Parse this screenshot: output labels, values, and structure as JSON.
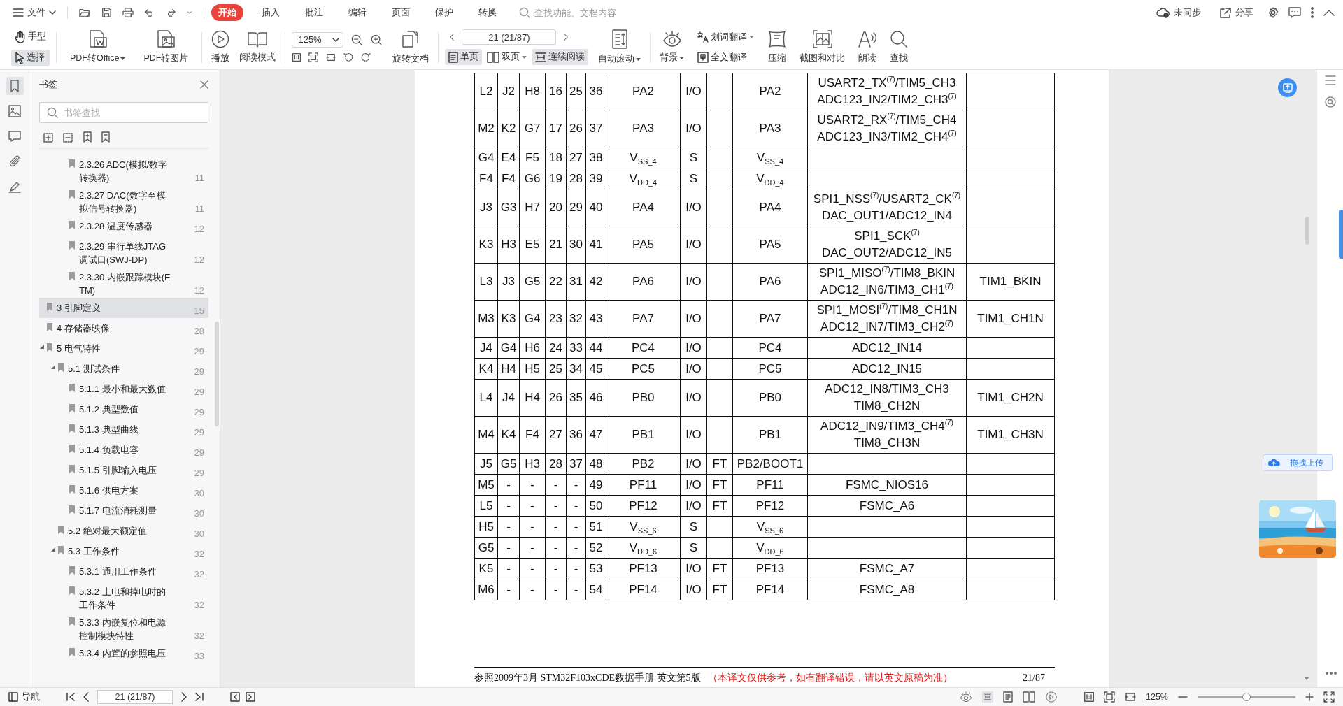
{
  "menu": {
    "file": "文件",
    "tabs": [
      {
        "label": "开始",
        "selected": true
      },
      {
        "label": "插入",
        "selected": false
      },
      {
        "label": "批注",
        "selected": false
      },
      {
        "label": "编辑",
        "selected": false
      },
      {
        "label": "页面",
        "selected": false
      },
      {
        "label": "保护",
        "selected": false
      },
      {
        "label": "转换",
        "selected": false
      }
    ],
    "search": {
      "placeholder": "查找功能、文档内容"
    },
    "sync": "未同步",
    "share": "分享"
  },
  "toolbar": {
    "tools": [
      {
        "label": "手型",
        "selected": false
      },
      {
        "label": "选择",
        "selected": true
      }
    ],
    "convert": [
      {
        "label": "PDF转Office",
        "dropdown": true
      },
      {
        "label": "PDF转图片",
        "dropdown": false
      }
    ],
    "view": [
      {
        "label": "播放"
      },
      {
        "label": "阅读模式"
      }
    ],
    "zoom": {
      "value": "125%"
    },
    "rotate": {
      "label": "旋转文档"
    },
    "page": {
      "value": "21 (21/87)"
    },
    "layouts": [
      {
        "label": "单页",
        "selected": true,
        "dropdown": false
      },
      {
        "label": "双页",
        "selected": false,
        "dropdown": true
      },
      {
        "label": "连续阅读",
        "selected": true,
        "dropdown": false
      }
    ],
    "autoscroll": {
      "label": "自动滚动",
      "dropdown": true
    },
    "background": {
      "label": "背景",
      "dropdown": true
    },
    "translate": [
      {
        "label": "划词翻译",
        "dropdown": true
      },
      {
        "label": "全文翻译",
        "dropdown": false
      }
    ],
    "more": [
      {
        "label": "压缩"
      },
      {
        "label": "截图和对比"
      },
      {
        "label": "朗读"
      },
      {
        "label": "查找"
      }
    ]
  },
  "sidebar": {
    "tabs": [
      {
        "selected": true
      },
      {
        "selected": false
      },
      {
        "selected": false
      },
      {
        "selected": false
      },
      {
        "selected": false
      }
    ],
    "title": "书签",
    "search": {
      "placeholder": "书签查找"
    },
    "bookmarks": [
      {
        "children": [
          {
            "children": [
              {
                "label": "2.3.26 ADC(模拟/数字转换器)",
                "page": "11",
                "selected": false
              },
              {
                "label": "2.3.27 DAC(数字至模拟信号转换器)",
                "page": "11",
                "selected": false
              },
              {
                "label": "2.3.28 温度传感器",
                "page": "12",
                "selected": false
              },
              {
                "label": "2.3.29 串行单线JTAG调试口(SWJ-DP)",
                "page": "12",
                "selected": false
              },
              {
                "label": "2.3.30 内嵌跟踪模块(ETM)",
                "page": "12",
                "selected": false
              }
            ]
          }
        ]
      },
      {
        "label": "3 引脚定义",
        "page": "15",
        "selected": true
      },
      {
        "label": "4 存储器映像",
        "page": "28",
        "selected": false
      },
      {
        "label": "5 电气特性",
        "page": "29",
        "selected": false,
        "expanded": true,
        "children": [
          {
            "label": "5.1 测试条件",
            "page": "29",
            "selected": false,
            "expanded": true,
            "children": [
              {
                "label": "5.1.1 最小和最大数值",
                "page": "29",
                "selected": false
              },
              {
                "label": "5.1.2 典型数值",
                "page": "29",
                "selected": false
              },
              {
                "label": "5.1.3 典型曲线",
                "page": "29",
                "selected": false
              },
              {
                "label": "5.1.4 负载电容",
                "page": "29",
                "selected": false
              },
              {
                "label": "5.1.5 引脚输入电压",
                "page": "29",
                "selected": false
              },
              {
                "label": "5.1.6 供电方案",
                "page": "30",
                "selected": false
              },
              {
                "label": "5.1.7 电流消耗测量",
                "page": "30",
                "selected": false
              }
            ]
          },
          {
            "label": "5.2 绝对最大额定值",
            "page": "30",
            "selected": false
          },
          {
            "label": "5.3 工作条件",
            "page": "32",
            "selected": false,
            "expanded": true,
            "children": [
              {
                "label": "5.3.1 通用工作条件",
                "page": "32",
                "selected": false
              },
              {
                "label": "5.3.2 上电和掉电时的工作条件",
                "page": "32",
                "selected": false
              },
              {
                "label": "5.3.3 内嵌复位和电源控制模块特性",
                "page": "32",
                "selected": false
              },
              {
                "label": "5.3.4 内置的参照电压",
                "page": "33",
                "selected": false
              }
            ]
          }
        ]
      }
    ]
  },
  "document": {
    "table": {
      "rows": [
        [
          "L2",
          "J2",
          "H8",
          "16",
          "25",
          "36",
          "PA2",
          "I/O",
          null,
          "PA2",
          "USART2_TX$^{(7)}$/TIM5_CH3\nADC123_IN2/TIM2_CH3$^{(7)}$",
          null
        ],
        [
          "M2",
          "K2",
          "G7",
          "17",
          "26",
          "37",
          "PA3",
          "I/O",
          null,
          "PA3",
          "USART2_RX$^{(7)}$/TIM5_CH4\nADC123_IN3/TIM2_CH4$^{(7)}$",
          null
        ],
        [
          "G4",
          "E4",
          "F5",
          "18",
          "27",
          "38",
          "V$_{SS_4}$",
          "S",
          null,
          "V$_{SS_4}$",
          null,
          null
        ],
        [
          "F4",
          "F4",
          "G6",
          "19",
          "28",
          "39",
          "V$_{DD_4}$",
          "S",
          null,
          "V$_{DD_4}$",
          null,
          null
        ],
        [
          "J3",
          "G3",
          "H7",
          "20",
          "29",
          "40",
          "PA4",
          "I/O",
          null,
          "PA4",
          "SPI1_NSS$^{(7)}$/USART2_CK$^{(7)}$\nDAC_OUT1/ADC12_IN4",
          null
        ],
        [
          "K3",
          "H3",
          "E5",
          "21",
          "30",
          "41",
          "PA5",
          "I/O",
          null,
          "PA5",
          "SPI1_SCK$^{(7)}$\nDAC_OUT2/ADC12_IN5",
          null
        ],
        [
          "L3",
          "J3",
          "G5",
          "22",
          "31",
          "42",
          "PA6",
          "I/O",
          null,
          "PA6",
          "SPI1_MISO$^{(7)}$/TIM8_BKIN\nADC12_IN6/TIM3_CH1$^{(7)}$",
          "TIM1_BKIN"
        ],
        [
          "M3",
          "K3",
          "G4",
          "23",
          "32",
          "43",
          "PA7",
          "I/O",
          null,
          "PA7",
          "SPI1_MOSI$^{(7)}$/TIM8_CH1N\nADC12_IN7/TIM3_CH2$^{(7)}$",
          "TIM1_CH1N"
        ],
        [
          "J4",
          "G4",
          "H6",
          "24",
          "33",
          "44",
          "PC4",
          "I/O",
          null,
          "PC4",
          "ADC12_IN14",
          null
        ],
        [
          "K4",
          "H4",
          "H5",
          "25",
          "34",
          "45",
          "PC5",
          "I/O",
          null,
          "PC5",
          "ADC12_IN15",
          null
        ],
        [
          "L4",
          "J4",
          "H4",
          "26",
          "35",
          "46",
          "PB0",
          "I/O",
          null,
          "PB0",
          "ADC12_IN8/TIM3_CH3\nTIM8_CH2N",
          "TIM1_CH2N"
        ],
        [
          "M4",
          "K4",
          "F4",
          "27",
          "36",
          "47",
          "PB1",
          "I/O",
          null,
          "PB1",
          "ADC12_IN9/TIM3_CH4$^{(7)}$\nTIM8_CH3N",
          "TIM1_CH3N"
        ],
        [
          "J5",
          "G5",
          "H3",
          "28",
          "37",
          "48",
          "PB2",
          "I/O",
          "FT",
          "PB2/BOOT1",
          null,
          null
        ],
        [
          "M5",
          "-",
          "-",
          "-",
          "-",
          "49",
          "PF11",
          "I/O",
          "FT",
          "PF11",
          "FSMC_NIOS16",
          null
        ],
        [
          "L5",
          "-",
          "-",
          "-",
          "-",
          "50",
          "PF12",
          "I/O",
          "FT",
          "PF12",
          "FSMC_A6",
          null
        ],
        [
          "H5",
          "-",
          "-",
          "-",
          "-",
          "51",
          "V$_{SS_6}$",
          "S",
          null,
          "V$_{SS_6}$",
          null,
          null
        ],
        [
          "G5",
          "-",
          "-",
          "-",
          "-",
          "52",
          "V$_{DD_6}$",
          "S",
          null,
          "V$_{DD_6}$",
          null,
          null
        ],
        [
          "K5",
          "-",
          "-",
          "-",
          "-",
          "53",
          "PF13",
          "I/O",
          "FT",
          "PF13",
          "FSMC_A7",
          null
        ],
        [
          "M6",
          "-",
          "-",
          "-",
          "-",
          "54",
          "PF14",
          "I/O",
          "FT",
          "PF14",
          "FSMC_A8",
          null
        ]
      ]
    },
    "footer": {
      "source": "参照2009年3月 STM32F103xCDE数据手册 英文第5版",
      "note": "（本译文仅供参考，如有翻译错误，请以英文原稿为准）",
      "page": "21/87"
    }
  },
  "upload_button": "拖拽上传",
  "status_bar": {
    "navigation": "导航",
    "page": "21 (21/87)",
    "zoom": "125%",
    "zoom_slider": {
      "level": 0.5
    }
  }
}
